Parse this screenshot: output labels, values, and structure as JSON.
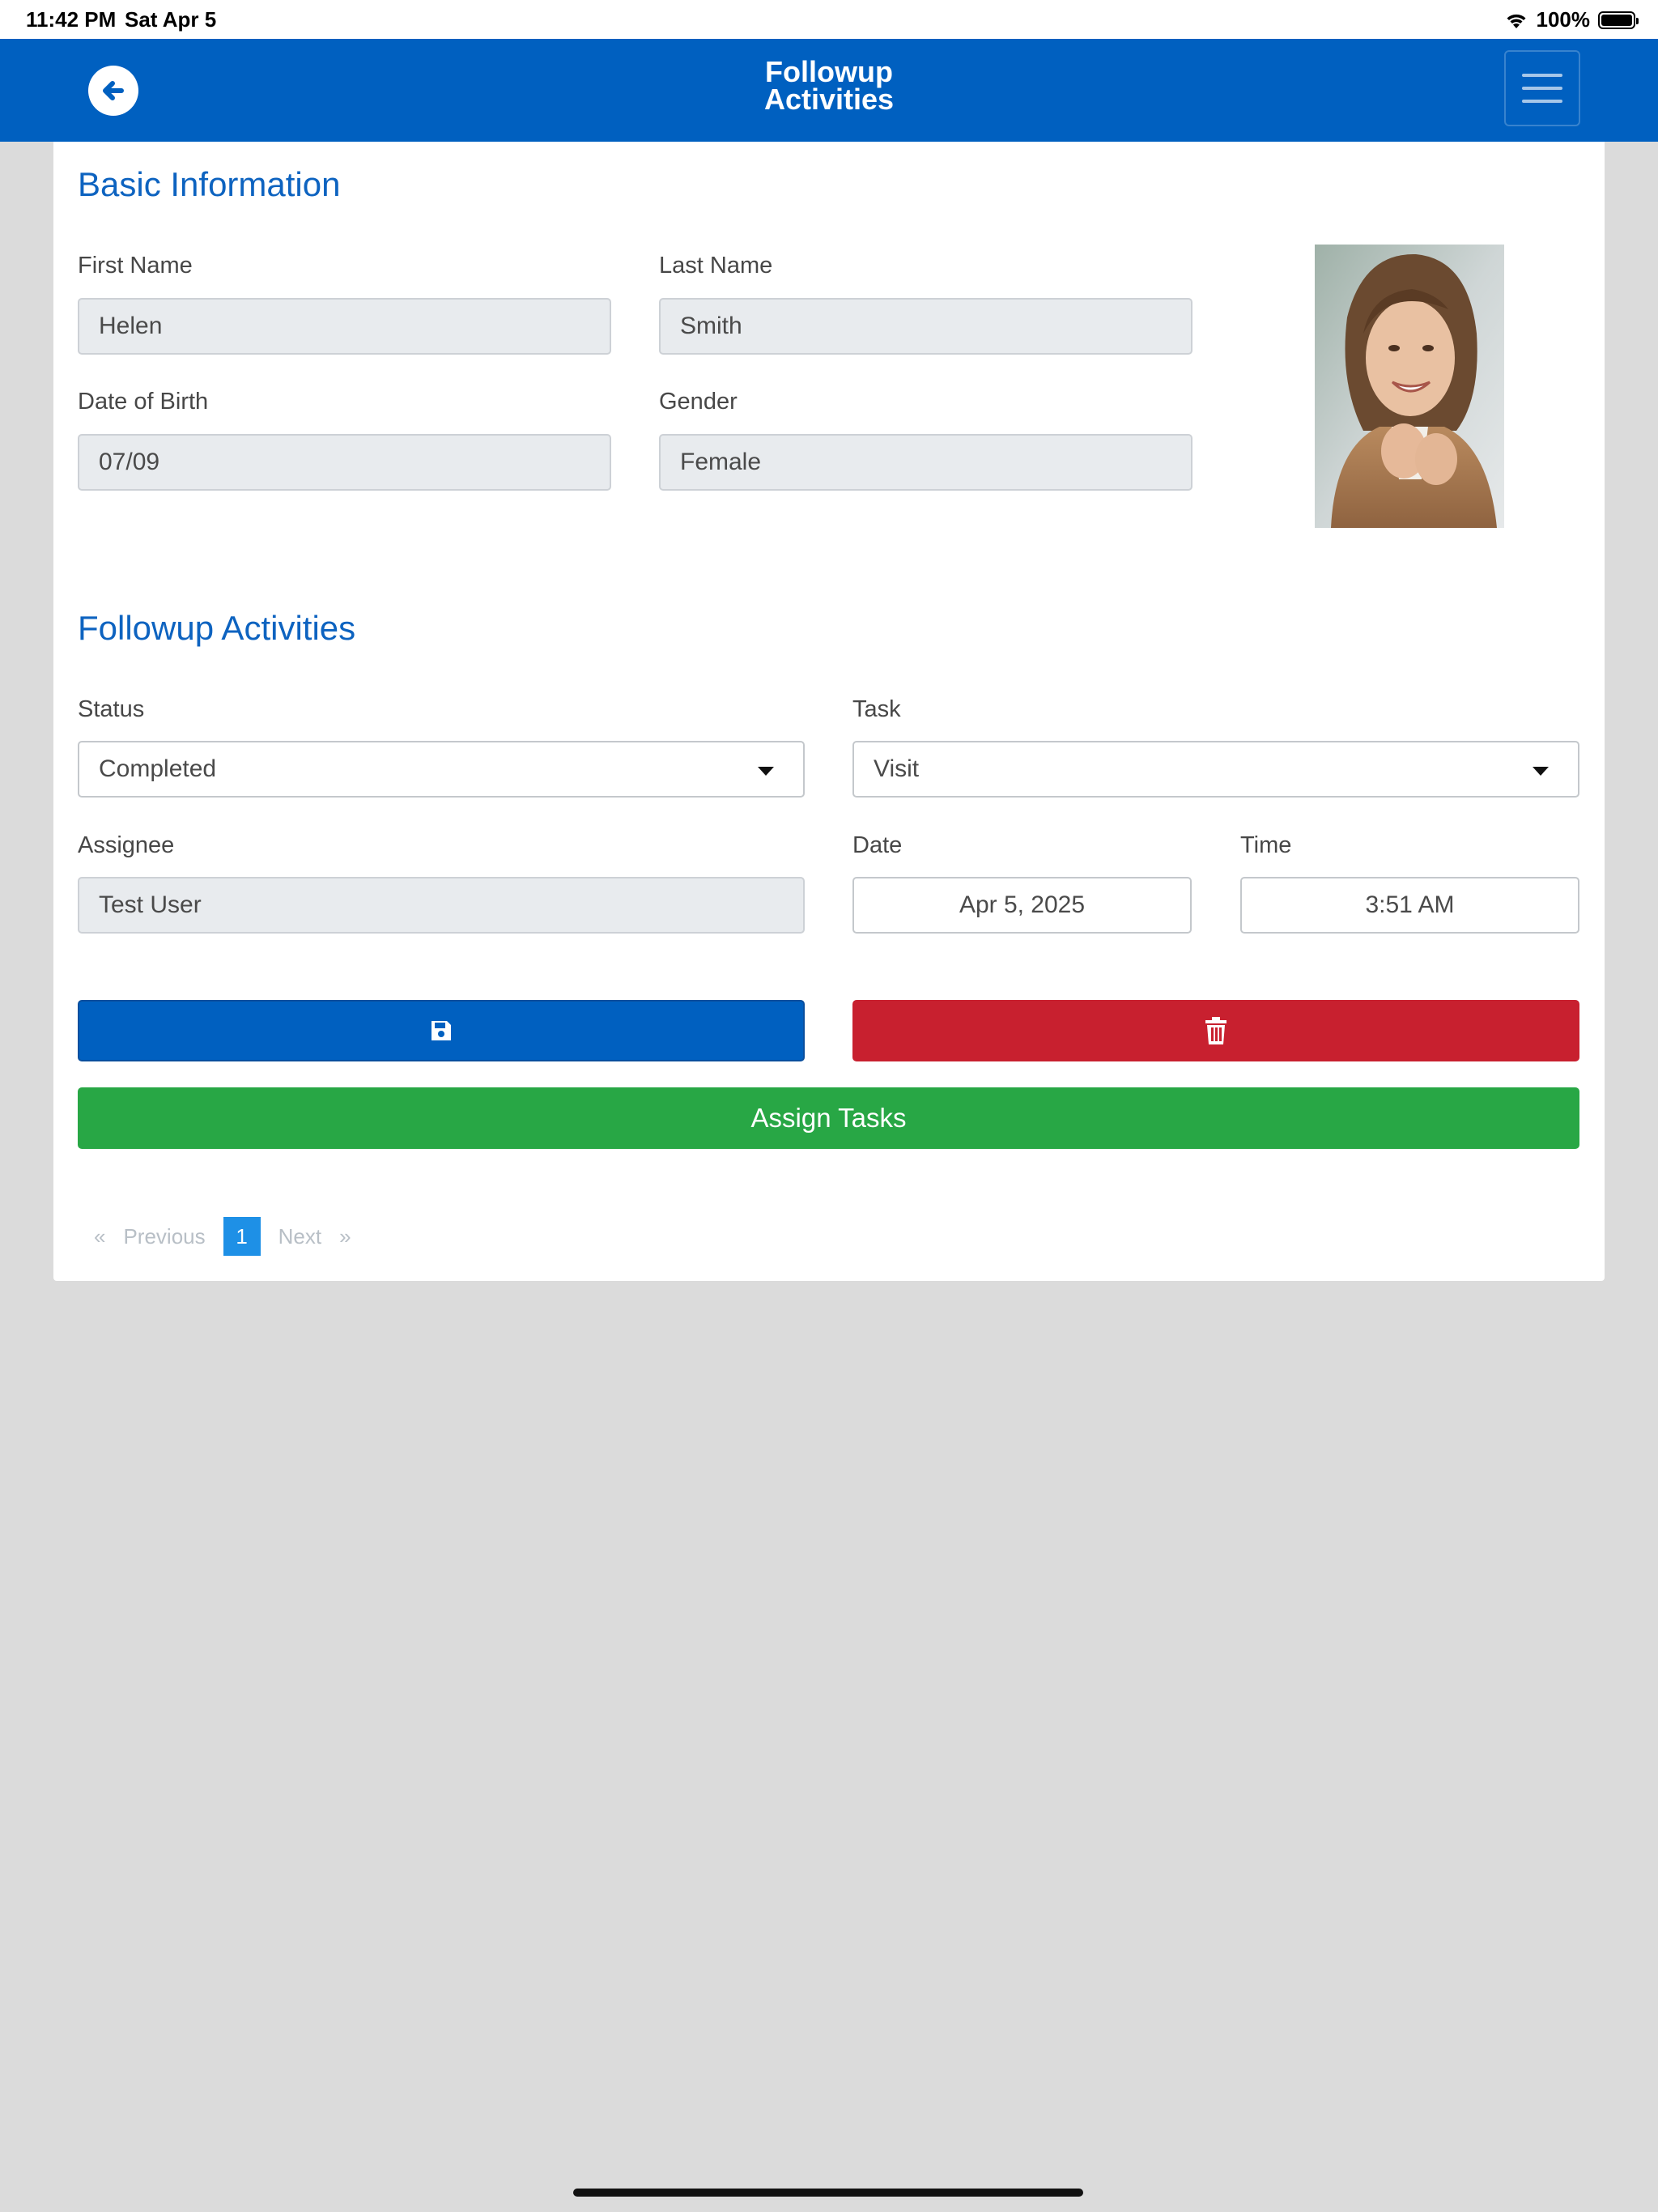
{
  "status_bar": {
    "time": "11:42 PM",
    "date": "Sat Apr 5",
    "battery": "100%"
  },
  "header": {
    "title_line1": "Followup",
    "title_line2": "Activities"
  },
  "basic_info": {
    "title": "Basic Information",
    "first_name": {
      "label": "First Name",
      "value": "Helen"
    },
    "last_name": {
      "label": "Last Name",
      "value": "Smith"
    },
    "dob": {
      "label": "Date of Birth",
      "value": "07/09"
    },
    "gender": {
      "label": "Gender",
      "value": "Female"
    }
  },
  "followup": {
    "title": "Followup Activities",
    "status": {
      "label": "Status",
      "value": "Completed"
    },
    "task": {
      "label": "Task",
      "value": "Visit"
    },
    "assignee": {
      "label": "Assignee",
      "value": "Test User"
    },
    "date": {
      "label": "Date",
      "value": "Apr 5, 2025"
    },
    "time": {
      "label": "Time",
      "value": "3:51 AM"
    },
    "assign_button": "Assign Tasks"
  },
  "pagination": {
    "first": "«",
    "previous": "Previous",
    "current_page": "1",
    "next": "Next",
    "last": "»"
  },
  "colors": {
    "primary": "#0060c0",
    "danger": "#c8202f",
    "success": "#28a745",
    "active_page": "#1e90e6"
  },
  "icons": [
    "back-arrow-icon",
    "hamburger-menu-icon",
    "save-icon",
    "trash-icon",
    "wifi-icon",
    "battery-icon",
    "dropdown-caret-icon"
  ]
}
